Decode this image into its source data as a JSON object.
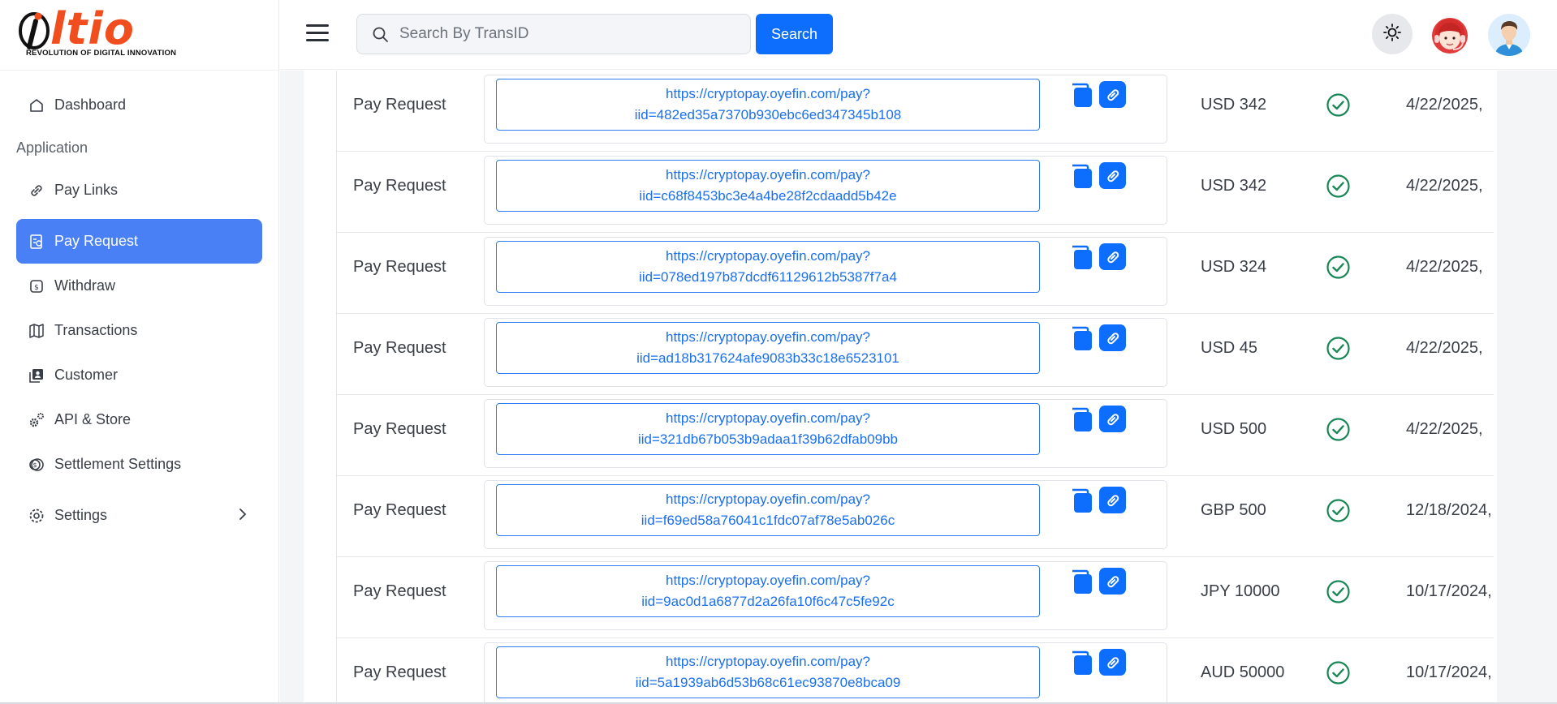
{
  "brand": {
    "logo_text": "iltio",
    "tagline": "REVOLUTION OF DIGITAL INNOVATION"
  },
  "sidebar": {
    "section_label": "Application",
    "items": [
      {
        "label": "Dashboard",
        "icon": "home-icon"
      },
      {
        "label": "Pay Links",
        "icon": "link-icon"
      },
      {
        "label": "Pay Request",
        "icon": "invoice-icon",
        "active": true
      },
      {
        "label": "Withdraw",
        "icon": "withdraw-icon"
      },
      {
        "label": "Transactions",
        "icon": "map-icon"
      },
      {
        "label": "Customer",
        "icon": "contacts-icon"
      },
      {
        "label": "API & Store",
        "icon": "gears-icon"
      },
      {
        "label": "Settlement Settings",
        "icon": "coins-icon"
      },
      {
        "label": "Settings",
        "icon": "gear-icon"
      }
    ]
  },
  "search": {
    "placeholder": "Search By TransID",
    "button_label": "Search"
  },
  "colors": {
    "primary": "#0d6efd",
    "active_nav": "#4a80f5",
    "success": "#198754",
    "logo_orange": "#f04e1e"
  },
  "table": {
    "rows": [
      {
        "type": "Pay Request",
        "link_line1": "https://cryptopay.oyefin.com/pay?",
        "link_line2": "iid=482ed35a7370b930ebc6ed347345b108",
        "amount": "USD 342",
        "date": "4/22/2025,"
      },
      {
        "type": "Pay Request",
        "link_line1": "https://cryptopay.oyefin.com/pay?",
        "link_line2": "iid=c68f8453bc3e4a4be28f2cdaadd5b42e",
        "amount": "USD 342",
        "date": "4/22/2025,"
      },
      {
        "type": "Pay Request",
        "link_line1": "https://cryptopay.oyefin.com/pay?",
        "link_line2": "iid=078ed197b87dcdf61129612b5387f7a4",
        "amount": "USD 324",
        "date": "4/22/2025,"
      },
      {
        "type": "Pay Request",
        "link_line1": "https://cryptopay.oyefin.com/pay?",
        "link_line2": "iid=ad18b317624afe9083b33c18e6523101",
        "amount": "USD 45",
        "date": "4/22/2025,"
      },
      {
        "type": "Pay Request",
        "link_line1": "https://cryptopay.oyefin.com/pay?",
        "link_line2": "iid=321db67b053b9adaa1f39b62dfab09bb",
        "amount": "USD 500",
        "date": "4/22/2025,"
      },
      {
        "type": "Pay Request",
        "link_line1": "https://cryptopay.oyefin.com/pay?",
        "link_line2": "iid=f69ed58a76041c1fdc07af78e5ab026c",
        "amount": "GBP 500",
        "date": "12/18/2024,"
      },
      {
        "type": "Pay Request",
        "link_line1": "https://cryptopay.oyefin.com/pay?",
        "link_line2": "iid=9ac0d1a6877d2a26fa10f6c47c5fe92c",
        "amount": "JPY 10000",
        "date": "10/17/2024,"
      },
      {
        "type": "Pay Request",
        "link_line1": "https://cryptopay.oyefin.com/pay?",
        "link_line2": "iid=5a1939ab6d53b68c61ec93870e8bca09",
        "amount": "AUD 50000",
        "date": "10/17/2024,"
      }
    ]
  }
}
